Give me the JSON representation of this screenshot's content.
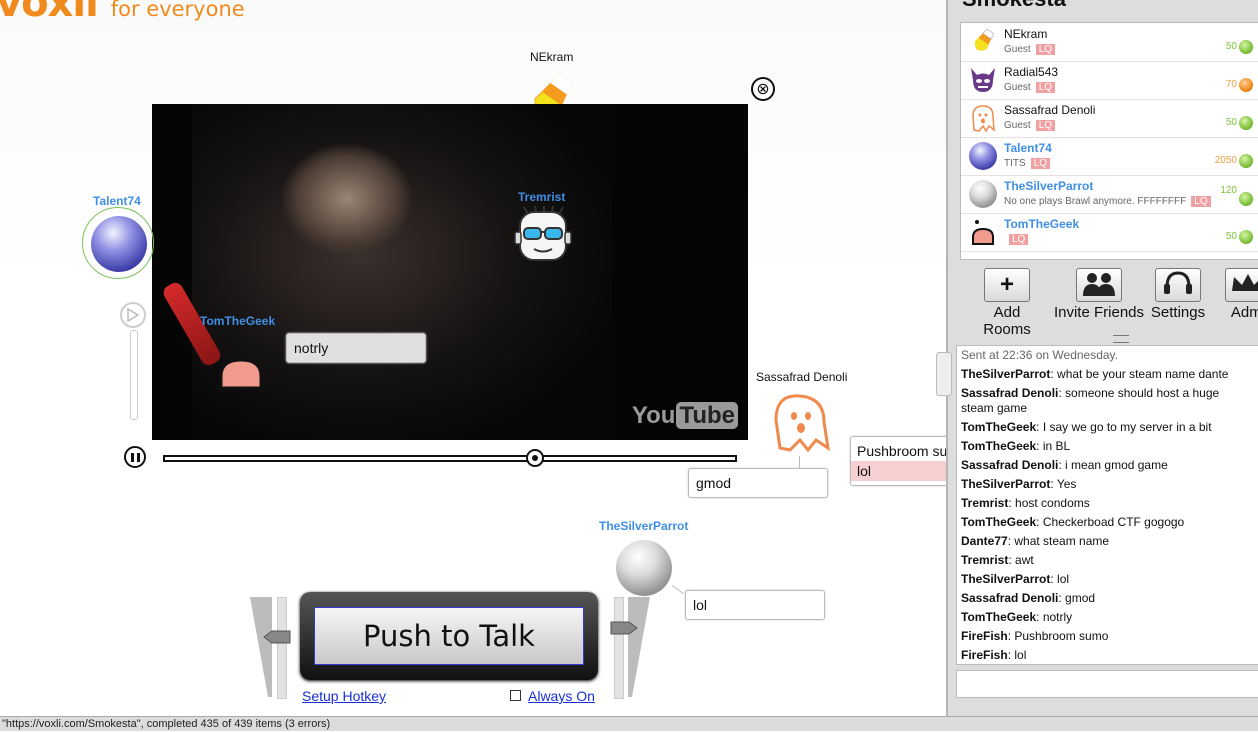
{
  "logo": {
    "brand": "voxli",
    "tagline": "for everyone"
  },
  "stage": {
    "users": {
      "nekram": "NEkram",
      "tremrist": "Tremrist",
      "talent74": "Talent74",
      "tomthegeek": "TomTheGeek",
      "sassafrad": "Sassafrad Denoli",
      "silverparrot": "TheSilverParrot"
    },
    "bubbles": {
      "tomthegeek": "notrly",
      "sassafrad": "gmod",
      "firefish_line1": "Pushbroom su",
      "firefish_line2": "lol",
      "silverparrot": "lol"
    },
    "video": {
      "watermark_you": "You",
      "watermark_tube": "Tube"
    },
    "close_glyph": "⊗",
    "ptt": {
      "label": "Push to Talk",
      "setup_hotkey": "Setup Hotkey",
      "always_on": "Always On"
    }
  },
  "sidebar": {
    "room_title": "Smokesta",
    "users": [
      {
        "name": "NEkram",
        "status": "Guest",
        "lq": "LQ",
        "points": "50",
        "dot": "#7fc23a",
        "ptcolor": "#7fc23a"
      },
      {
        "name": "Radial543",
        "status": "Guest",
        "lq": "LQ",
        "points": "70",
        "dot": "#f08a1c",
        "ptcolor": "#f0a040"
      },
      {
        "name": "Sassafrad Denoli",
        "status": "Guest",
        "lq": "LQ",
        "points": "50",
        "dot": "#7fc23a",
        "ptcolor": "#7fc23a"
      },
      {
        "name": "Talent74",
        "status": "TITS",
        "lq": "LQ",
        "points": "2050",
        "dot": "#7fc23a",
        "ptcolor": "#f0a040"
      },
      {
        "name": "TheSilverParrot",
        "status": "No one plays Brawl anymore. FFFFFFFF",
        "lq": "LQ",
        "points": "120",
        "dot": "#7fc23a",
        "ptcolor": "#7fc23a"
      },
      {
        "name": "TomTheGeek",
        "status": "",
        "lq": "LQ",
        "points": "50",
        "dot": "#7fc23a",
        "ptcolor": "#7fc23a"
      }
    ],
    "toolbar": {
      "add": "Add Rooms",
      "invite": "Invite Friends",
      "settings": "Settings",
      "admin": "Admi"
    },
    "chat_header": "Sent at 22:36 on Wednesday.",
    "chat": [
      {
        "user": "TheSilverParrot",
        "msg": "what be your steam name dante"
      },
      {
        "user": "Sassafrad Denoli",
        "msg": "someone should host a huge steam game"
      },
      {
        "user": "TomTheGeek",
        "msg": "I say we go to my server in a bit"
      },
      {
        "user": "TomTheGeek",
        "msg": "in BL"
      },
      {
        "user": "Sassafrad Denoli",
        "msg": "i mean gmod game"
      },
      {
        "user": "TheSilverParrot",
        "msg": "Yes"
      },
      {
        "user": "Tremrist",
        "msg": "host condoms"
      },
      {
        "user": "TomTheGeek",
        "msg": "Checkerboad CTF gogogo"
      },
      {
        "user": "Dante77",
        "msg": "what steam name"
      },
      {
        "user": "Tremrist",
        "msg": "awt"
      },
      {
        "user": "TheSilverParrot",
        "msg": "lol"
      },
      {
        "user": "Sassafrad Denoli",
        "msg": "gmod"
      },
      {
        "user": "TomTheGeek",
        "msg": "notrly"
      },
      {
        "user": "FireFish",
        "msg": "Pushbroom sumo"
      },
      {
        "user": "FireFish",
        "msg": "lol"
      }
    ]
  },
  "statusbar": "\"https://voxli.com/Smokesta\", completed 435 of 439 items (3 errors)"
}
